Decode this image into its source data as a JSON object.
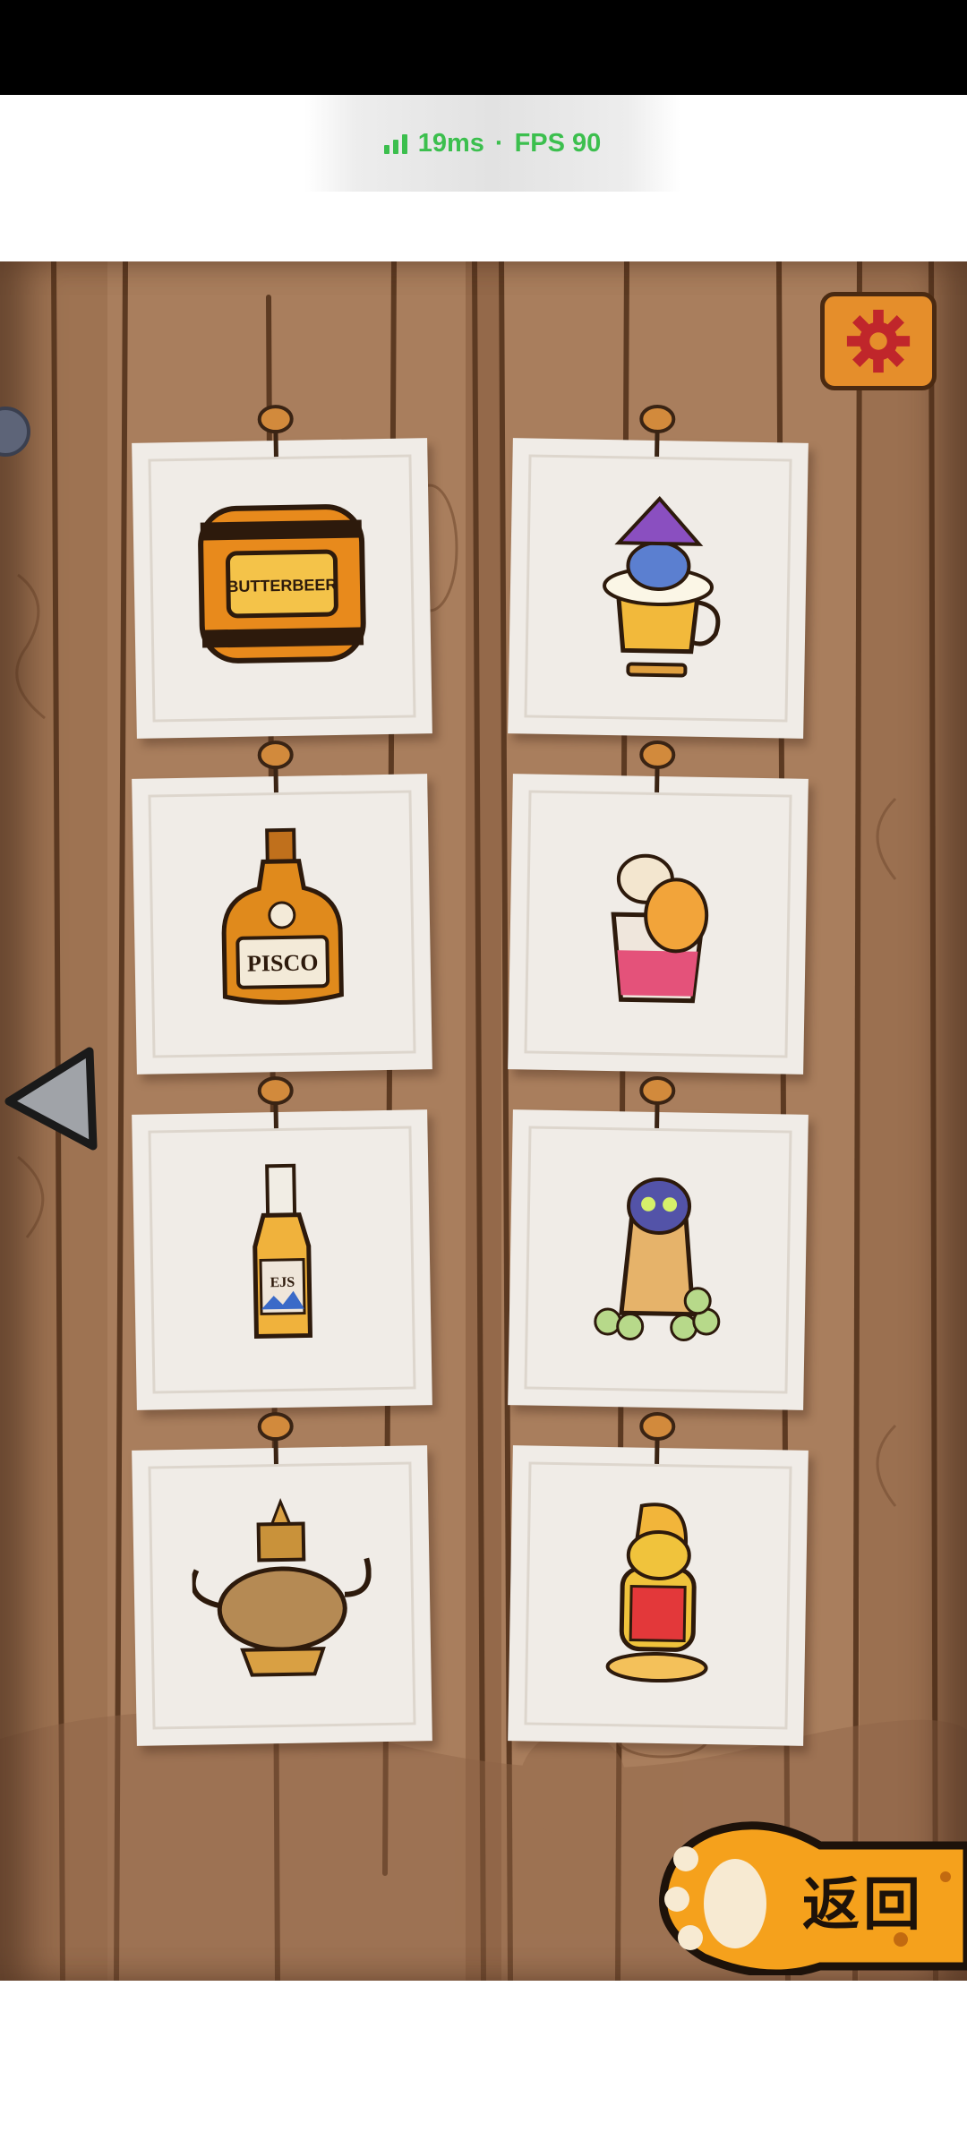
{
  "status": {
    "ping": "19ms",
    "separator": "·",
    "fps": "FPS 90"
  },
  "header": {
    "settings_icon": "gear-icon"
  },
  "nav": {
    "back_icon": "triangle-left-icon"
  },
  "items": [
    {
      "id": "butterbeer",
      "label": "BUTTERBEER",
      "icon": "barrel-icon"
    },
    {
      "id": "wizard-cat-mug",
      "label": "",
      "icon": "beer-mug-icon"
    },
    {
      "id": "pisco",
      "label": "PISCO",
      "icon": "bottle-icon"
    },
    {
      "id": "llama-cat-glass",
      "label": "",
      "icon": "glass-icon"
    },
    {
      "id": "liquor-bottle",
      "label": "EJS",
      "icon": "bottle-icon"
    },
    {
      "id": "cat-grape-glass",
      "label": "",
      "icon": "glass-icon"
    },
    {
      "id": "teapot",
      "label": "",
      "icon": "teapot-icon"
    },
    {
      "id": "cat-bottle",
      "label": "",
      "icon": "cat-icon"
    }
  ],
  "footer": {
    "return_label": "返回"
  }
}
